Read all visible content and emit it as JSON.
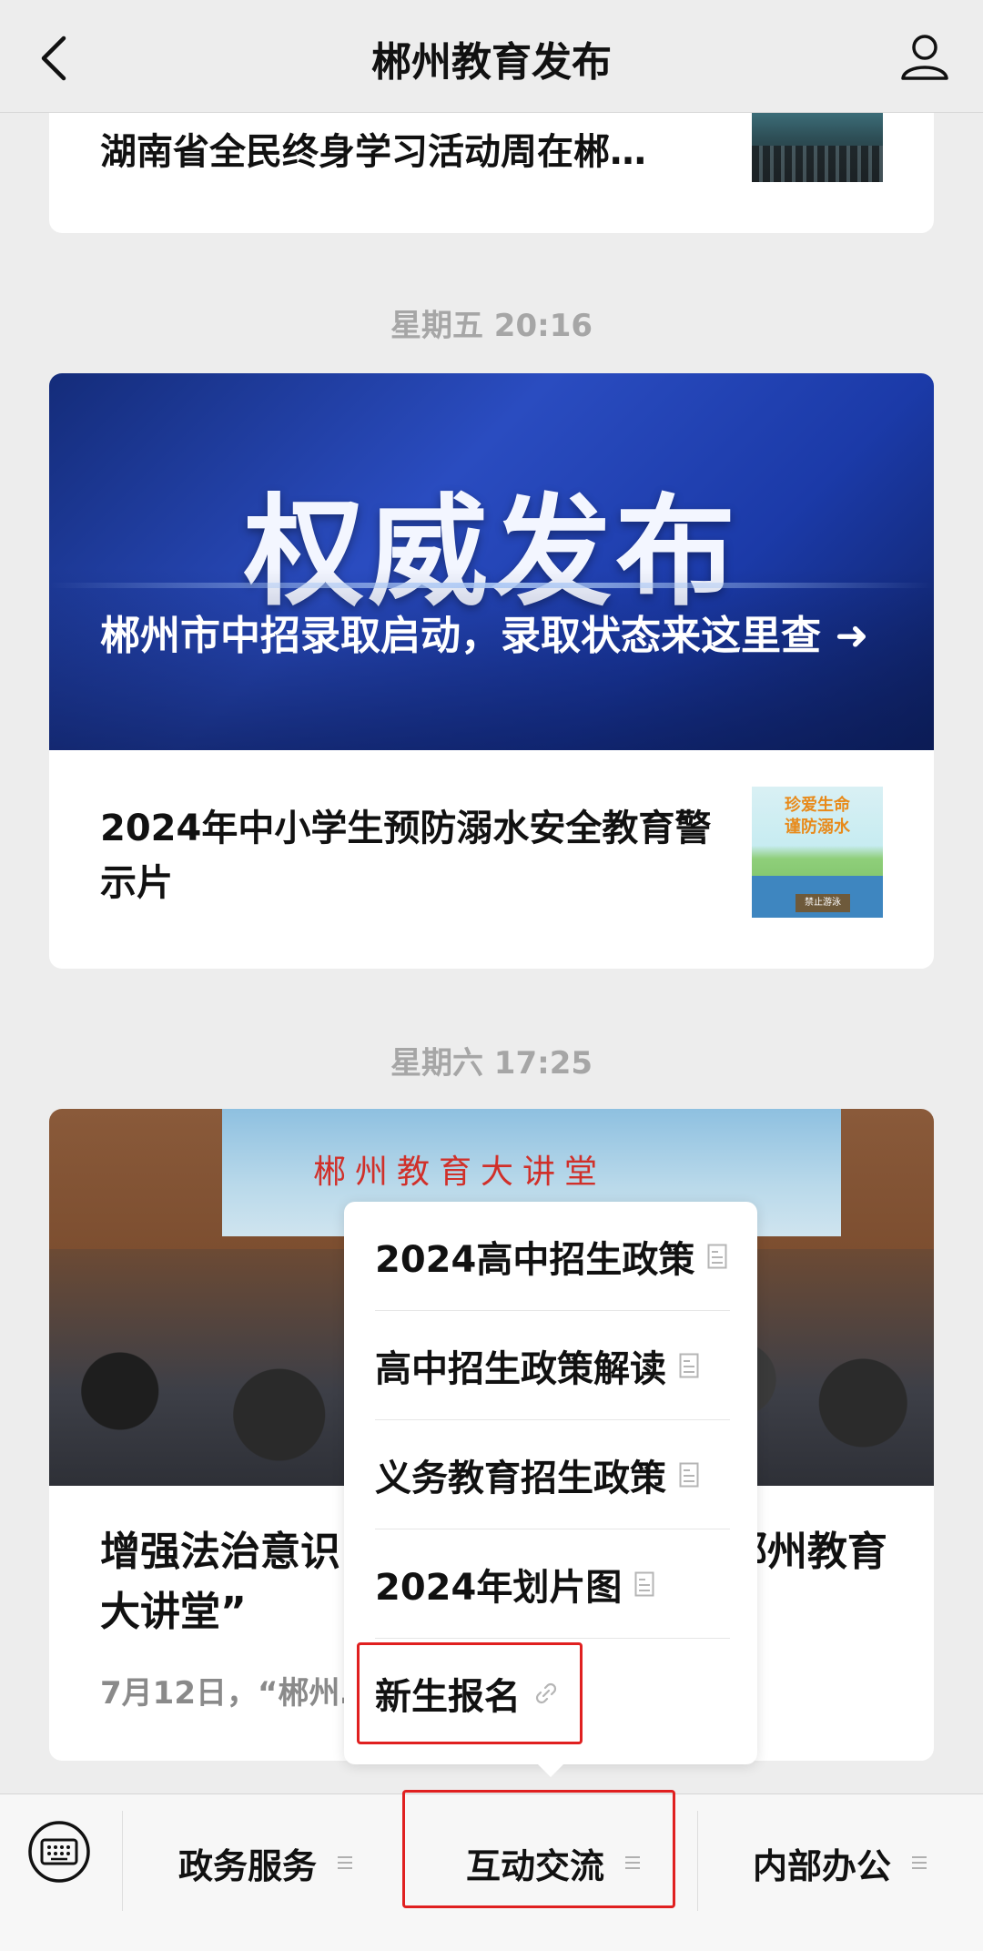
{
  "header": {
    "title": "郴州教育发布",
    "back_icon": "chevron-left-icon",
    "user_icon": "person-icon"
  },
  "feed": {
    "card1": {
      "title": "湖南省全民终身学习活动周在郴…"
    },
    "timestamp1": "星期五 20:16",
    "card2": {
      "banner_text": "权威发布",
      "headline": "郴州市中招录取启动，录取状态来这里查 ➜",
      "sub_title": "2024年中小学生预防溺水安全教育警示片",
      "thumb_text_1": "珍爱生命",
      "thumb_text_2": "谨防溺水",
      "thumb_sign": "禁止游泳"
    },
    "timestamp2": "星期六 17:25",
    "card3": {
      "screen_text": "郴州教育大讲堂",
      "title": "增强法治意识，筑牢安全防线——“郴州教育大讲堂”",
      "desc": "7月12日，“郴州…"
    }
  },
  "popup_menu": {
    "items": [
      {
        "label": "2024高中招生政策",
        "icon": "article-icon"
      },
      {
        "label": "高中招生政策解读",
        "icon": "article-icon"
      },
      {
        "label": "义务教育招生政策",
        "icon": "article-icon"
      },
      {
        "label": "2024年划片图",
        "icon": "article-icon"
      },
      {
        "label": "新生报名",
        "icon": "link-icon"
      }
    ]
  },
  "bottom_bar": {
    "keyboard_icon": "keyboard-icon",
    "tabs": [
      {
        "label": "政务服务"
      },
      {
        "label": "互动交流"
      },
      {
        "label": "内部办公"
      }
    ]
  },
  "colors": {
    "background": "#ededed",
    "highlight": "#e02020",
    "banner_blue": "#1b3aa8"
  }
}
